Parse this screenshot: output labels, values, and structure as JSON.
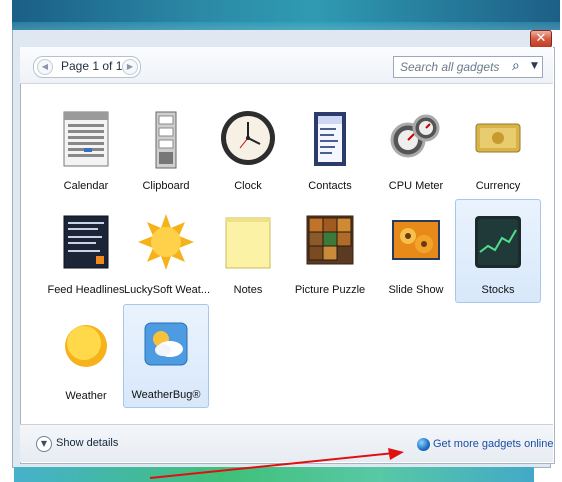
{
  "window": {
    "close_glyph": "✕"
  },
  "pager": {
    "label": "Page 1 of 1",
    "prev_glyph": "◀",
    "next_glyph": "▶"
  },
  "search": {
    "placeholder": "Search all gadgets",
    "icon": "search-icon",
    "dropdown_glyph": "▼"
  },
  "gadgets": [
    {
      "label": "Calendar",
      "icon": "calendar-icon",
      "selected": false
    },
    {
      "label": "Clipboard",
      "icon": "clipboard-icon",
      "selected": false
    },
    {
      "label": "Clock",
      "icon": "clock-icon",
      "selected": false
    },
    {
      "label": "Contacts",
      "icon": "contacts-icon",
      "selected": false
    },
    {
      "label": "CPU Meter",
      "icon": "cpu-meter-icon",
      "selected": false
    },
    {
      "label": "Currency",
      "icon": "currency-icon",
      "selected": false
    },
    {
      "label": "Feed Headlines",
      "icon": "feed-headlines-icon",
      "selected": false
    },
    {
      "label": "LuckySoft Weat...",
      "icon": "sun-icon",
      "selected": false
    },
    {
      "label": "Notes",
      "icon": "notes-icon",
      "selected": false
    },
    {
      "label": "Picture Puzzle",
      "icon": "picture-puzzle-icon",
      "selected": false
    },
    {
      "label": "Slide Show",
      "icon": "slide-show-icon",
      "selected": false
    },
    {
      "label": "Stocks",
      "icon": "stocks-icon",
      "selected": true
    },
    {
      "label": "Weather",
      "icon": "weather-sun-icon",
      "selected": false
    },
    {
      "label": "WeatherBug®",
      "icon": "weatherbug-icon",
      "selected": true
    }
  ],
  "footer": {
    "details_label": "Show details",
    "details_glyph": "▼",
    "online_label": "Get more gadgets online"
  },
  "colors": {
    "accent": "#1a4ea8",
    "selection": "#d8e8fa",
    "annotation_arrow": "#e01010"
  }
}
